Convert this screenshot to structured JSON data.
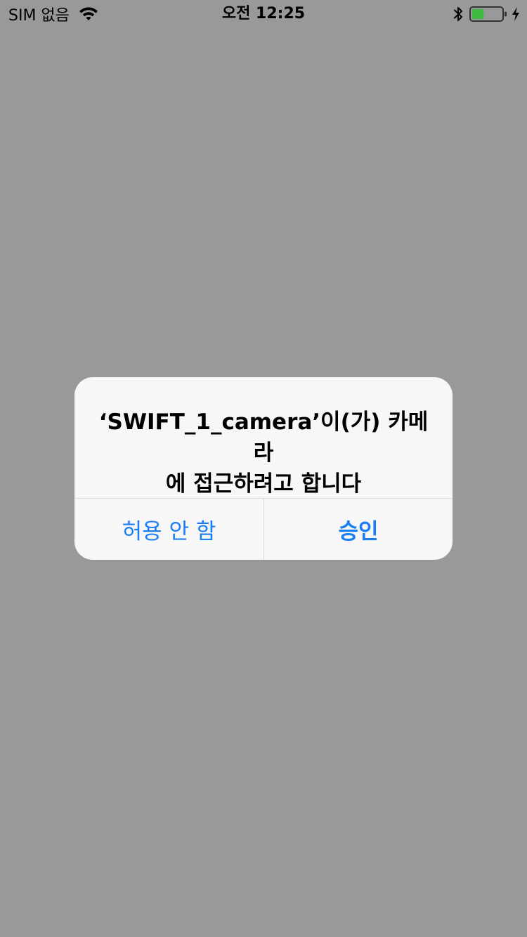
{
  "status_bar": {
    "carrier": "SIM 없음",
    "time": "오전 12:25",
    "wifi_icon": "wifi-icon",
    "bluetooth_icon": "bluetooth-icon",
    "battery_icon": "battery-icon",
    "battery_level": 0.4,
    "battery_color": "#3fbb3f",
    "charging_icon": "charging-bolt-icon"
  },
  "alert": {
    "message_line1": "‘SWIFT_1_camera’이(가) 카메라",
    "message_line2": "에 접근하려고 합니다",
    "deny_label": "허용 안 함",
    "allow_label": "승인",
    "button_color": "#1a7ef2"
  },
  "colors": {
    "background_dim": "#999999",
    "alert_bg": "#f7f7f7"
  }
}
